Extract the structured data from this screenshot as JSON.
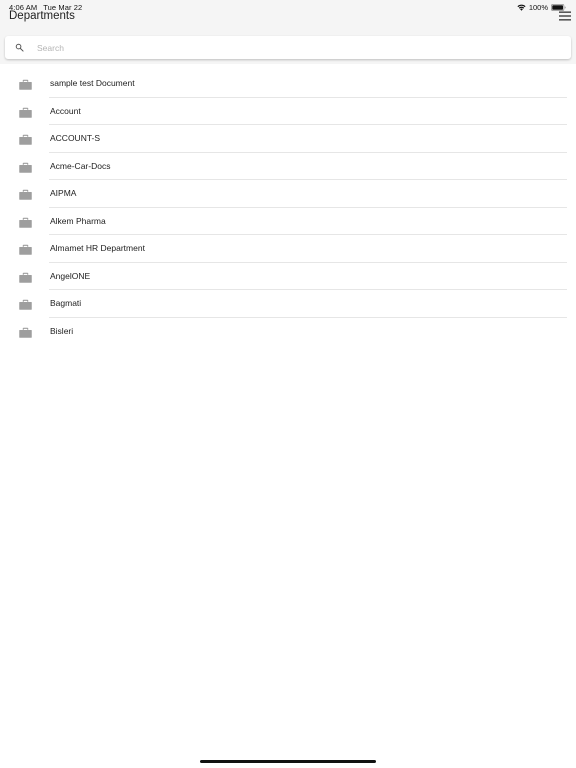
{
  "status_bar": {
    "time": "4:06 AM",
    "date": "Tue Mar 22",
    "battery": "100%",
    "icons": [
      "wifi-icon",
      "battery-icon"
    ]
  },
  "header": {
    "title": "Departments",
    "menu_icon": "hamburger-menu-icon"
  },
  "search": {
    "placeholder": "Search",
    "value": "",
    "icon": "search-icon"
  },
  "departments": {
    "item_icon": "briefcase-icon",
    "items": [
      {
        "label": "sample test Document"
      },
      {
        "label": "Account"
      },
      {
        "label": "ACCOUNT-S"
      },
      {
        "label": "Acme-Car-Docs"
      },
      {
        "label": "AIPMA"
      },
      {
        "label": "Alkem Pharma"
      },
      {
        "label": "Almamet HR Department"
      },
      {
        "label": "AngelONE"
      },
      {
        "label": "Bagmati"
      },
      {
        "label": "Bisleri"
      }
    ]
  },
  "colors": {
    "header_background": "#f5f5f5",
    "icon_gray": "#9e9e9e",
    "divider": "#e6e6e6",
    "placeholder": "#b4b4b4"
  }
}
